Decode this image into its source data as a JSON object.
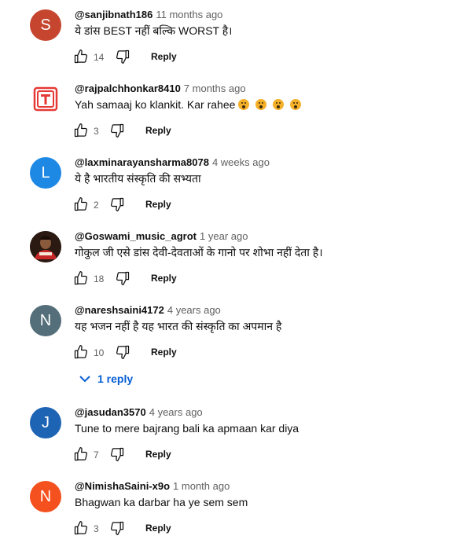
{
  "reply_label": "Reply",
  "comments": [
    {
      "avatar_letter": "S",
      "avatar_color": "#c6452f",
      "author": "@sanjibnath186",
      "time": "11 months ago",
      "text": "ये डांस BEST नहीं बल्कि WORST है।",
      "likes": "14"
    },
    {
      "avatar_letter": "",
      "avatar_color": "#e53935",
      "author": "@rajpalchhonkar8410",
      "time": "7 months ago",
      "text": "Yah samaaj ko klankit. Kar rahee",
      "likes": "3"
    },
    {
      "avatar_letter": "L",
      "avatar_color": "#1e88e5",
      "author": "@laxminarayansharma8078",
      "time": "4 weeks ago",
      "text": "ये है भारतीय संस्कृति की सभ्यता",
      "likes": "2"
    },
    {
      "avatar_letter": "",
      "avatar_color": "#2a1a12",
      "author": "@Goswami_music_agrot",
      "time": "1 year ago",
      "text": "गोकुल जी एसे डांस देवी-देवताओं के गानो पर शोभा नहीं देता है।",
      "likes": "18"
    },
    {
      "avatar_letter": "N",
      "avatar_color": "#546e7a",
      "author": "@nareshsaini4172",
      "time": "4 years ago",
      "text": "यह भजन नहीं है यह भारत की संस्कृति का अपमान है",
      "likes": "10",
      "replies_label": "1 reply"
    },
    {
      "avatar_letter": "J",
      "avatar_color": "#1e64b4",
      "author": "@jasudan3570",
      "time": "4 years ago",
      "text": "Tune to mere bajrang bali ka apmaan kar diya",
      "likes": "7"
    },
    {
      "avatar_letter": "N",
      "avatar_color": "#f4511e",
      "author": "@NimishaSaini-x9o",
      "time": "1 month ago",
      "text": "Bhagwan ka darbar ha ye sem sem",
      "likes": "3"
    }
  ]
}
